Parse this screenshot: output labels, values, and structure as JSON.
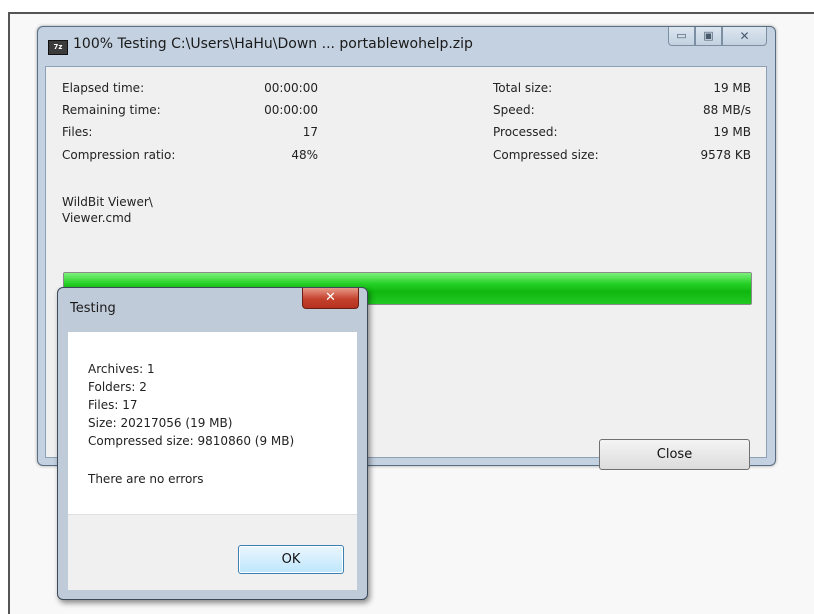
{
  "window": {
    "icon_text": "7z",
    "title": "100% Testing C:\\Users\\HaHu\\Down ... portablewohelp.zip",
    "minimize_glyph": "▭",
    "maximize_glyph": "▣",
    "close_glyph": "✕"
  },
  "stats_left": [
    {
      "label": "Elapsed time:",
      "value": "00:00:00"
    },
    {
      "label": "Remaining time:",
      "value": "00:00:00"
    },
    {
      "label": "Files:",
      "value": "17"
    },
    {
      "label": "Compression ratio:",
      "value": "48%"
    }
  ],
  "stats_right": [
    {
      "label": "Total size:",
      "value": "19 MB"
    },
    {
      "label": "Speed:",
      "value": "88 MB/s"
    },
    {
      "label": "Processed:",
      "value": "19 MB"
    },
    {
      "label": "Compressed size:",
      "value": "9578 KB"
    }
  ],
  "current_path": [
    "WildBit Viewer\\",
    "Viewer.cmd"
  ],
  "progress": {
    "percent": 100,
    "color": "#1ec81e"
  },
  "buttons": {
    "close": "Close"
  },
  "dialog": {
    "title": "Testing",
    "close_glyph": "✕",
    "lines": [
      "Archives: 1",
      "Folders: 2",
      "Files: 17",
      "Size: 20217056 (19 MB)",
      "Compressed size: 9810860 (9 MB)"
    ],
    "message": "There are no errors",
    "ok_label": "OK"
  }
}
